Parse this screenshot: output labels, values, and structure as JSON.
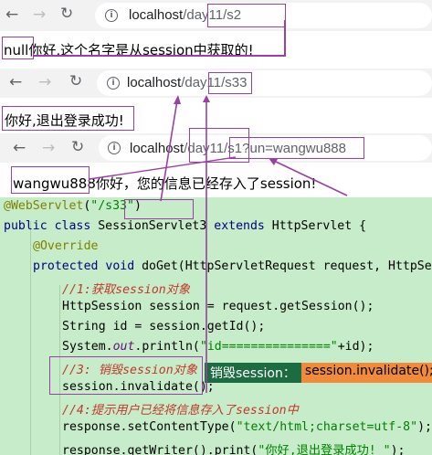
{
  "screens": [
    {
      "url_host": "localhost",
      "url_path": "/day11/s2",
      "message": "null你好,这个名字是从session中获取的!"
    },
    {
      "url_host": "localhost",
      "url_path": "/day11/s33",
      "message": "你好,退出登录成功!"
    },
    {
      "url_host": "localhost",
      "url_path": "/day11/s1?un=wangwu888",
      "message": "wangwu888你好，您的信息已经存入了session!"
    }
  ],
  "code": {
    "l1a": "@WebServlet",
    "l1b": "(",
    "l1c": "\"/s33\"",
    "l1d": ")",
    "l2a": "public class ",
    "l2b": "SessionServlet3 ",
    "l2c": "extends ",
    "l2d": "HttpServlet {",
    "l3": "@Override",
    "l4a": "protected void ",
    "l4b": "doGet(HttpServletRequest request, HttpServ",
    "l5": "//1:获取session对象",
    "l6": "HttpSession session = request.getSession();",
    "l7": "String id = session.getId();",
    "l8a": "System.",
    "l8b": "out",
    "l8c": ".println(",
    "l8d": "\"id===============\"",
    "l8e": "+id);",
    "l9": "//3: 销毁session对象",
    "l10": "session.invalidate();",
    "l11": "//4:提示用户已经将信息存入了session中",
    "l12a": "response.setContentType(",
    "l12b": "\"text/html;charset=utf-8\"",
    "l12c": ");",
    "l13a": "response.getWriter().print(",
    "l13b": "\"你好,退出登录成功! \"",
    "l13c": ");"
  },
  "tooltip": {
    "label": "销毁session：",
    "value": "session.invalidate();"
  },
  "colors": {
    "annotation_purple": "#9b3fa6",
    "code_background": "#c7ecc9",
    "tooltip_green": "#1d6b40",
    "tooltip_orange": "#f08a3c"
  }
}
